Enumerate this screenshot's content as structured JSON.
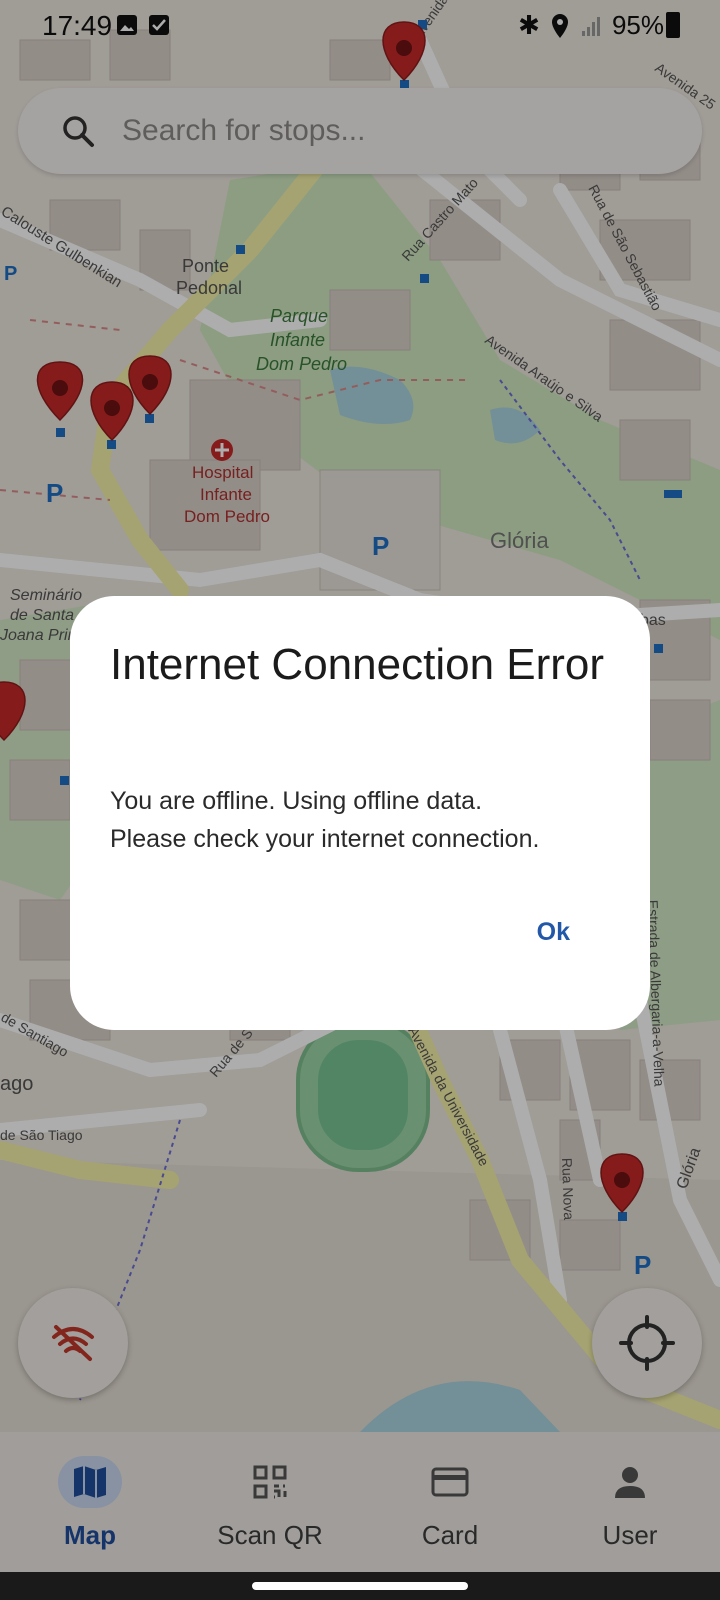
{
  "status_bar": {
    "time": "17:49",
    "battery": "95%"
  },
  "search": {
    "placeholder": "Search for stops..."
  },
  "map": {
    "labels": {
      "ponte": "Ponte",
      "pedonal": "Pedonal",
      "parque1": "Parque",
      "parque2": "Infante",
      "parque3": "Dom Pedro",
      "hospital1": "Hospital",
      "hospital2": "Infante",
      "hospital3": "Dom Pedro",
      "gloria": "Glória",
      "calouste": "Calouste Gulbenkian",
      "castro": "Rua Castro Mato",
      "saosebastiao": "Rua de São Sebastião",
      "araujo": "Avenida Araújo e Silva",
      "universidade": "Avenida da Universidade",
      "ruanova": "Rua Nova",
      "albergaria": "Estrada de Albergaria-a-Velha",
      "seminario1": "Seminário",
      "seminario2": "de Santa",
      "seminario3": "Joana Princ",
      "santiago": "de Santiago",
      "ago": "ago",
      "saotiago": "de São Tiago",
      "ruade": "Rua de S",
      "avenida25": "Avenida 25",
      "avenidasa": "Avenida de Sa",
      "bas": "bas",
      "gloria2": "Glória"
    }
  },
  "dialog": {
    "title": "Internet Connection Error",
    "message": "You are offline. Using offline data.\nPlease check your internet connection.",
    "ok_label": "Ok"
  },
  "nav": {
    "items": [
      {
        "label": "Map",
        "icon": "map-icon",
        "active": true
      },
      {
        "label": "Scan QR",
        "icon": "qr-code-icon",
        "active": false
      },
      {
        "label": "Card",
        "icon": "card-icon",
        "active": false
      },
      {
        "label": "User",
        "icon": "user-icon",
        "active": false
      }
    ]
  },
  "colors": {
    "accent": "#2358a8",
    "offline_icon": "#c0392b",
    "pin": "#c62828",
    "stop": "#1e6fc4"
  }
}
